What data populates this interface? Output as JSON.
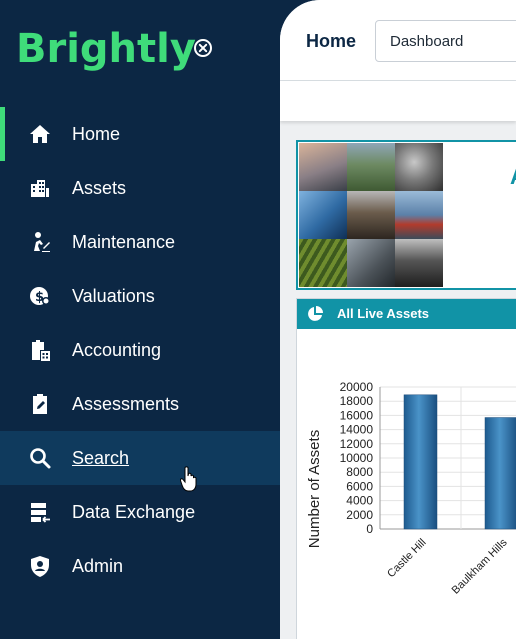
{
  "brand": {
    "name": "Brightly",
    "accent": "#3fdc7a"
  },
  "sidebar": {
    "items": [
      {
        "label": "Home",
        "icon": "home-icon",
        "state": "active"
      },
      {
        "label": "Assets",
        "icon": "buildings-icon"
      },
      {
        "label": "Maintenance",
        "icon": "worker-icon"
      },
      {
        "label": "Valuations",
        "icon": "dollar-gear-icon"
      },
      {
        "label": "Accounting",
        "icon": "clipboard-calculator-icon"
      },
      {
        "label": "Assessments",
        "icon": "clipboard-pen-icon"
      },
      {
        "label": "Search",
        "icon": "search-icon",
        "state": "hover"
      },
      {
        "label": "Data Exchange",
        "icon": "data-exchange-icon"
      },
      {
        "label": "Admin",
        "icon": "shield-user-icon"
      }
    ]
  },
  "header": {
    "title": "Home",
    "dashboard_select": "Dashboard"
  },
  "banner": {
    "partial_heading": "A"
  },
  "chart_card": {
    "title": "All Live Assets"
  },
  "chart_data": {
    "type": "bar",
    "categories": [
      "Castle Hill",
      "Baulkham Hills"
    ],
    "values": [
      18900,
      15700
    ],
    "title": "",
    "xlabel": "",
    "ylabel": "Number of Assets",
    "ylim": [
      0,
      20000
    ],
    "yticks": [
      0,
      2000,
      4000,
      6000,
      8000,
      10000,
      12000,
      14000,
      16000,
      18000,
      20000
    ],
    "grid": true,
    "bar_color": "#2a6fa6"
  }
}
